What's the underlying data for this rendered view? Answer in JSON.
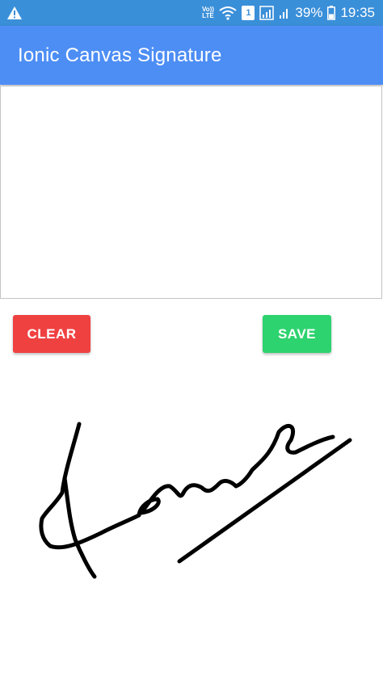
{
  "status_bar": {
    "volte_line1": "Vo))",
    "volte_line2": "LTE",
    "sim_slot": "1",
    "battery_percent": "39%",
    "time": "19:35",
    "background_color": "#3a8fd9"
  },
  "header": {
    "title": "Ionic Canvas Signature",
    "background_color": "#4d8ef5"
  },
  "actions": {
    "clear_label": "CLEAR",
    "save_label": "SAVE",
    "clear_color": "#f04141",
    "save_color": "#2dd36f"
  },
  "icons": {
    "warning": "warning-icon",
    "wifi": "wifi-icon",
    "signal": "signal-icon",
    "battery": "battery-icon"
  }
}
